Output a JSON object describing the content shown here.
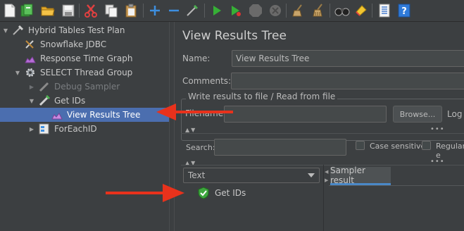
{
  "toolbar": {
    "icons": [
      "new-icon",
      "templates-icon",
      "open-icon",
      "save-icon",
      "cut-icon",
      "copy-icon",
      "paste-icon",
      "expand-icon",
      "collapse-icon",
      "toggle-icon",
      "start-icon",
      "start-no-pause-icon",
      "stop-icon",
      "shutdown-icon",
      "clear-icon",
      "clear-all-icon",
      "search-icon",
      "reset-search-icon",
      "function-helper-icon",
      "help-icon"
    ]
  },
  "tree": {
    "items": [
      {
        "label": "Hybrid Tables Test Plan",
        "icon": "test-plan-icon",
        "expanded": true
      },
      {
        "label": "Snowflake JDBC",
        "icon": "config-element-icon"
      },
      {
        "label": "Response Time Graph",
        "icon": "listener-icon"
      },
      {
        "label": "SELECT Thread Group",
        "icon": "thread-group-icon",
        "expanded": true
      },
      {
        "label": "Debug Sampler",
        "icon": "sampler-icon",
        "disabled": true,
        "collapsed": true
      },
      {
        "label": "Get IDs",
        "icon": "jdbc-sampler-icon",
        "expanded": true
      },
      {
        "label": "View Results Tree",
        "icon": "listener-icon",
        "selected": true
      },
      {
        "label": "ForEachID",
        "icon": "controller-icon",
        "collapsed": true
      }
    ]
  },
  "panel": {
    "title": "View Results Tree",
    "name_label": "Name:",
    "name_value": "View Results Tree",
    "comments_label": "Comments:",
    "comments_value": "",
    "write_results_label": "Write results to file / Read from file",
    "filename_label": "Filename",
    "filename_value": "",
    "browse_label": "Browse...",
    "log_label": "Log",
    "search_label": "Search:",
    "search_value": "",
    "case_sensitive_label": "Case sensitive",
    "regular_label": "Regular e",
    "renderer": "Text",
    "sampler_result_tab": "Sampler result",
    "results": [
      {
        "label": "Get IDs",
        "status": "success"
      }
    ]
  },
  "colors": {
    "selection": "#4b6eaf",
    "annotation_arrow": "#e8321c",
    "success": "#3ea63e"
  }
}
